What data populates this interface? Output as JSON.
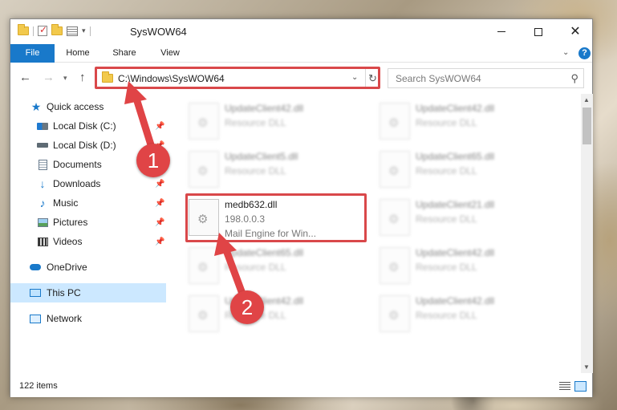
{
  "window": {
    "title": "SysWOW64",
    "controls": {
      "minimize": "—",
      "maximize": "☐",
      "close": "✕"
    }
  },
  "ribbon": {
    "tabs": [
      "File",
      "Home",
      "Share",
      "View"
    ],
    "help": "?"
  },
  "address": {
    "path": "C:\\Windows\\SysWOW64",
    "search_placeholder": "Search SysWOW64"
  },
  "sidebar": {
    "items": [
      {
        "label": "Quick access",
        "icon": "star-icon"
      },
      {
        "label": "Local Disk (C:)",
        "icon": "drive-icon",
        "pinned": true
      },
      {
        "label": "Local Disk (D:)",
        "icon": "drive-icon",
        "pinned": true
      },
      {
        "label": "Documents",
        "icon": "documents-icon",
        "pinned": true
      },
      {
        "label": "Downloads",
        "icon": "download-icon",
        "pinned": true
      },
      {
        "label": "Music",
        "icon": "music-icon",
        "pinned": true
      },
      {
        "label": "Pictures",
        "icon": "pictures-icon",
        "pinned": true
      },
      {
        "label": "Videos",
        "icon": "videos-icon",
        "pinned": true
      },
      {
        "label": "OneDrive",
        "icon": "onedrive-icon"
      },
      {
        "label": "This PC",
        "icon": "pc-icon",
        "selected": true
      },
      {
        "label": "Network",
        "icon": "network-icon"
      }
    ]
  },
  "files": {
    "highlighted": {
      "name": "medb632.dll",
      "version": "198.0.0.3",
      "description": "Mail Engine for Win..."
    },
    "background": [
      {
        "name": "UpdateClient42.dll",
        "type": "Resource DLL"
      },
      {
        "name": "UpdateClient42.dll",
        "type": "Resource DLL"
      },
      {
        "name": "UpdateClient5.dll",
        "type": "Resource DLL"
      },
      {
        "name": "UpdateClient65.dll",
        "type": "Resource DLL"
      },
      {
        "name": "UpdateClient21.dll",
        "type": "Resource DLL"
      },
      {
        "name": "UpdateClient65.dll",
        "type": "Resource DLL"
      },
      {
        "name": "UpdateClient42.dll",
        "type": "Resource DLL"
      },
      {
        "name": "UpdateClient42.dll",
        "type": "Resource DLL"
      },
      {
        "name": "UpdateClient42.dll",
        "type": "Resource DLL"
      }
    ]
  },
  "status": {
    "item_count": "122 items"
  },
  "annotations": {
    "step1": "1",
    "step2": "2",
    "highlight_color": "#d9484a"
  }
}
